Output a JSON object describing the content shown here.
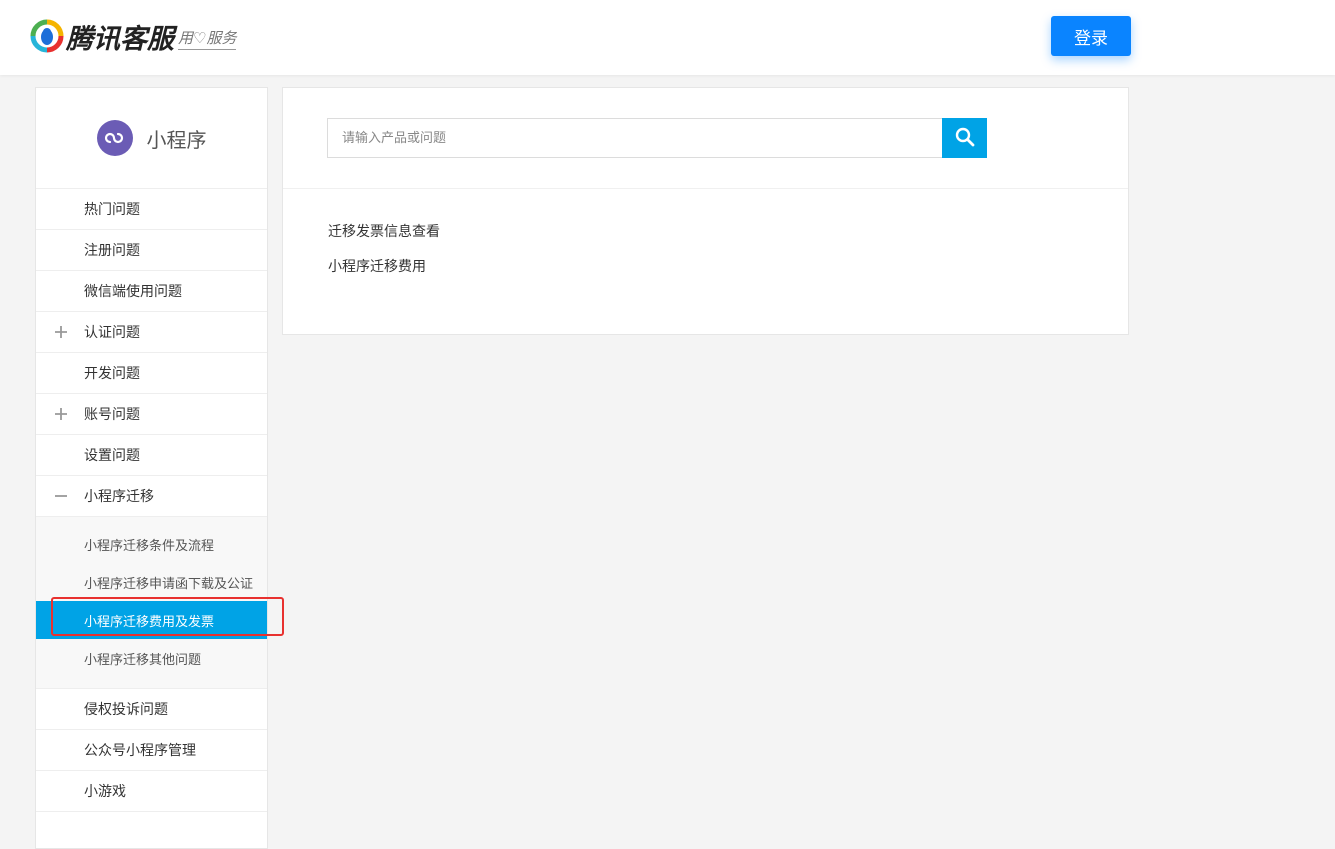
{
  "header": {
    "logo_title": "腾讯客服",
    "logo_slogan": "用♡服务",
    "login_label": "登录"
  },
  "sidebar": {
    "title": "小程序",
    "items": [
      {
        "label": "热门问题",
        "toggle": ""
      },
      {
        "label": "注册问题",
        "toggle": ""
      },
      {
        "label": "微信端使用问题",
        "toggle": ""
      },
      {
        "label": "认证问题",
        "toggle": "plus"
      },
      {
        "label": "开发问题",
        "toggle": ""
      },
      {
        "label": "账号问题",
        "toggle": "plus"
      },
      {
        "label": "设置问题",
        "toggle": ""
      },
      {
        "label": "小程序迁移",
        "toggle": "minus"
      }
    ],
    "subitems": [
      {
        "label": "小程序迁移条件及流程",
        "active": false
      },
      {
        "label": "小程序迁移申请函下载及公证",
        "active": false
      },
      {
        "label": "小程序迁移费用及发票",
        "active": true
      },
      {
        "label": "小程序迁移其他问题",
        "active": false
      }
    ],
    "items_after": [
      {
        "label": "侵权投诉问题"
      },
      {
        "label": "公众号小程序管理"
      },
      {
        "label": "小游戏"
      }
    ]
  },
  "search": {
    "placeholder": "请输入产品或问题"
  },
  "results": [
    "迁移发票信息查看",
    "小程序迁移费用"
  ],
  "colors": {
    "accent": "#00a3e6",
    "login_button": "#0a84ff",
    "highlight": "#e8312f",
    "brand_icon": "#6b5cb5"
  }
}
